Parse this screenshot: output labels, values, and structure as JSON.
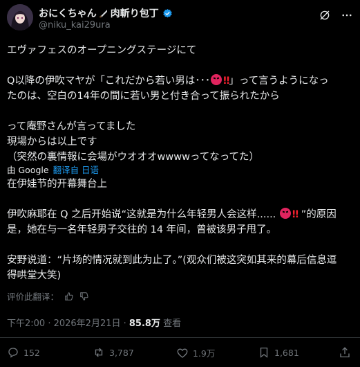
{
  "post": {
    "display_name": "おにくちゃん",
    "name_suffix": "肉斬り包丁",
    "handle": "@niku_kai29ura",
    "original_lines": [
      "エヴァフェスのオープニングステージにて",
      "",
      "Q以降の伊吹マヤが「これだから若い男は･･･",
      "」って言うようになっ",
      "たのは、空白の14年の間に若い男と付き合って振られたから",
      "",
      "って庵野さんが言ってました",
      "現場からは以上です",
      "（突然の裏情報に会場がウオオオwwwwってなってた）"
    ],
    "translation": {
      "by_label": "由 Google",
      "action_label": "翻译自 日语",
      "lines": [
        "在伊娃节的开幕舞台上",
        "",
        "伊吹麻耶在 Q 之后开始说“这就是为什么年轻男人会这样......",
        "”的原因",
        "是，她在与一名年轻男子交往的 14 年间，曾被该男子甩了。",
        "",
        "安野说道：“片场的情况就到此为止了。”(观众们被这突如其来的幕后信息逗",
        "得哄堂大笑)"
      ]
    },
    "rate_label": "评价此翻译：",
    "time": "下午2:00 · 2026年2月21日 · ",
    "views": "85.8万",
    "views_label": " 查看",
    "stats": {
      "replies": "152",
      "reposts": "3,787",
      "likes": "1.9万",
      "bookmarks": "1,681"
    },
    "colors": {
      "accent": "#1d9bf0",
      "verified": "#1d9bf0",
      "emoji": "#e0245e"
    }
  }
}
